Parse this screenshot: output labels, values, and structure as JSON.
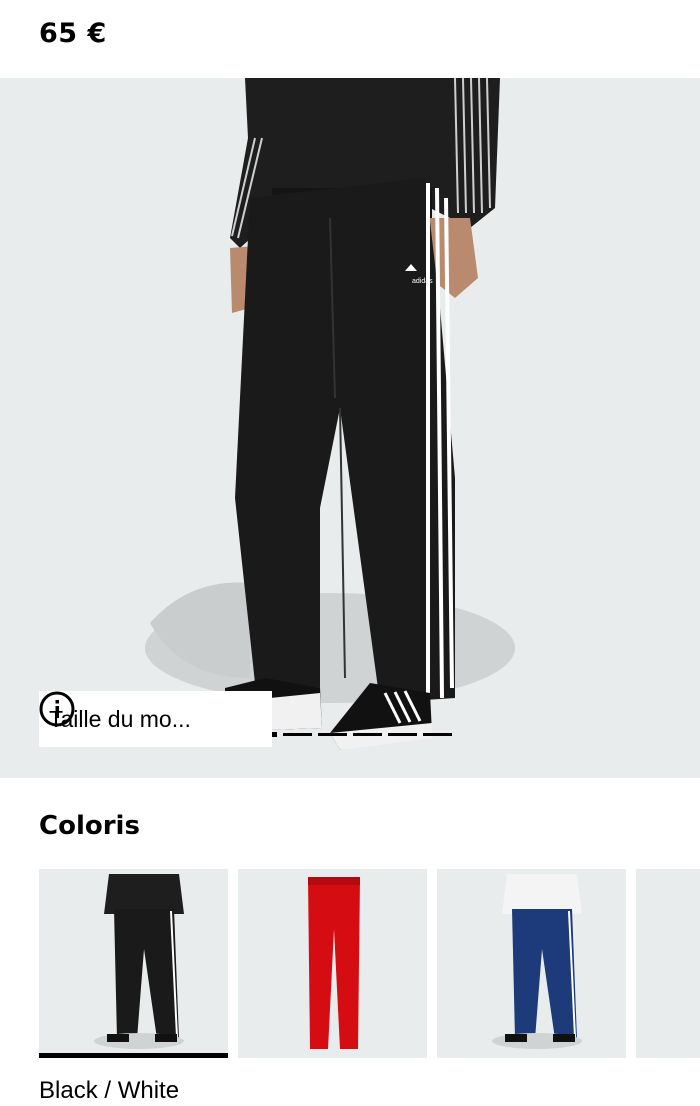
{
  "product": {
    "price": "65 €"
  },
  "hero": {
    "size_tag_label": "Taille du mo...",
    "logo_text": "adidas",
    "carousel_total": 6,
    "carousel_active_index": 0
  },
  "colors": {
    "title": "Coloris",
    "selected_name": "Black / White",
    "swatches": [
      {
        "name": "black-pants-swatch",
        "color": "#1a1a1a",
        "selected": true
      },
      {
        "name": "red-pants-swatch",
        "color": "#d50d12",
        "selected": false
      },
      {
        "name": "blue-pants-swatch",
        "color": "#1d3a7a",
        "selected": false
      },
      {
        "name": "partial-swatch",
        "color": "#e8ecec",
        "selected": false
      }
    ]
  }
}
